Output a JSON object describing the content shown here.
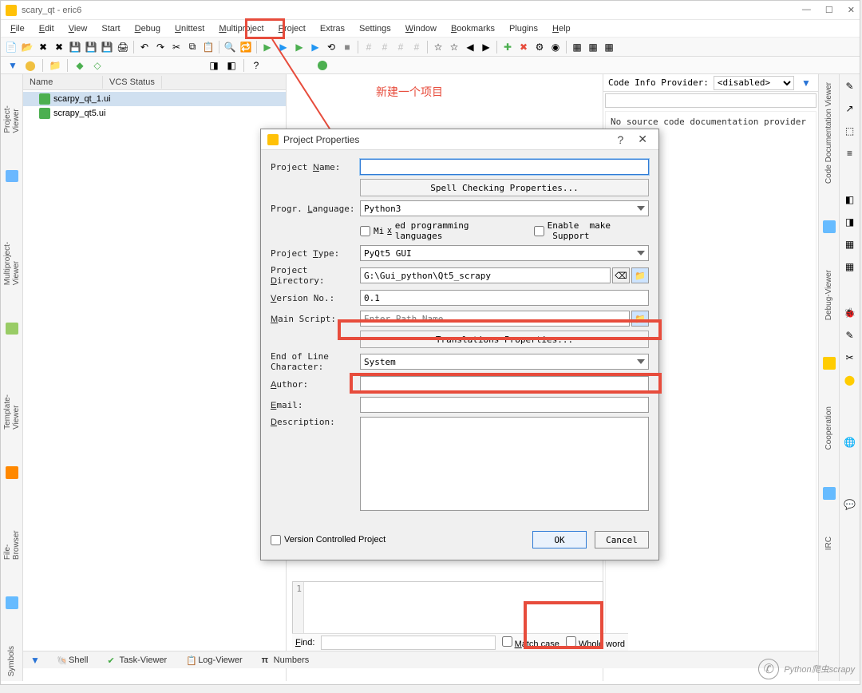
{
  "titlebar": {
    "text": "scary_qt - eric6"
  },
  "menu": {
    "file": "File",
    "edit": "Edit",
    "view": "View",
    "start": "Start",
    "debug": "Debug",
    "unittest": "Unittest",
    "multiproject": "Multiproject",
    "project": "Project",
    "extras": "Extras",
    "settings": "Settings",
    "window": "Window",
    "bookmarks": "Bookmarks",
    "plugins": "Plugins",
    "help": "Help"
  },
  "project_panel": {
    "col_name": "Name",
    "col_vcs": "VCS Status",
    "items": [
      "scarpy_qt_1.ui",
      "scrapy_qt5.ui"
    ]
  },
  "left_tabs": {
    "project_viewer": "Project-Viewer",
    "multiproject_viewer": "Multiproject-Viewer",
    "template_viewer": "Template-Viewer",
    "file_browser": "File-Browser",
    "symbols": "Symbols"
  },
  "right_tabs": {
    "code_doc": "Code Documentation Viewer",
    "debug_viewer": "Debug-Viewer",
    "cooperation": "Cooperation",
    "irc": "IRC"
  },
  "code_info": {
    "label": "Code Info Provider:",
    "value": "<disabled>"
  },
  "doc_text": "No source code documentation provider h",
  "annotation": {
    "text": "新建一个项目"
  },
  "dialog": {
    "title": "Project Properties",
    "project_name_label": "Project Name:",
    "project_name_value": "",
    "spell_btn": "Spell Checking Properties...",
    "lang_label": "Progr. Language:",
    "lang_value": "Python3",
    "mixed_label": "Mixed programming languages",
    "make_label": "Enable  make  Support",
    "type_label": "Project Type:",
    "type_value": "PyQt5 GUI",
    "dir_label": "Project Directory:",
    "dir_value": "G:\\Gui_python\\Qt5_scrapy",
    "version_label": "Version No.:",
    "version_value": "0.1",
    "main_label": "Main Script:",
    "main_placeholder": "Enter Path Name",
    "trans_btn": "Translations Properties...",
    "eol_label": "End of Line Character:",
    "eol_value": "System",
    "author_label": "Author:",
    "email_label": "Email:",
    "desc_label": "Description:",
    "vc_label": "Version Controlled Project",
    "ok": "OK",
    "cancel": "Cancel"
  },
  "find": {
    "label": "Find:",
    "match_case": "Match case",
    "whole_word": "Whole word"
  },
  "bottom_tabs": {
    "shell": "Shell",
    "task": "Task-Viewer",
    "log": "Log-Viewer",
    "numbers": "Numbers"
  },
  "editor_line": "1",
  "watermark": "Python爬虫scrapy"
}
